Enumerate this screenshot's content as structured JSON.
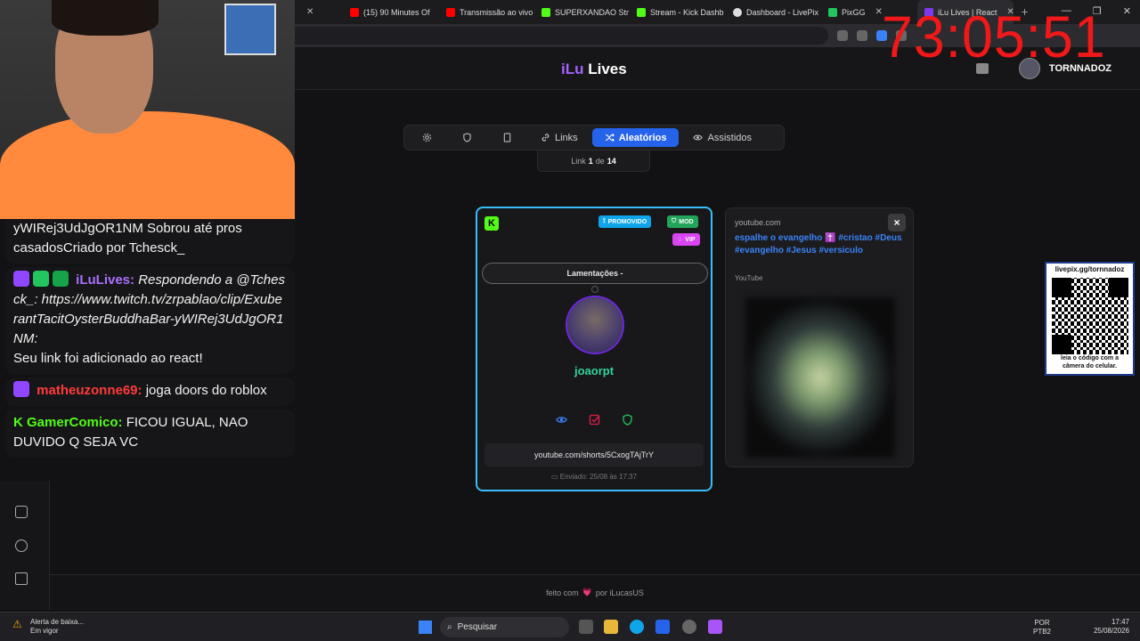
{
  "browser": {
    "tabs": [
      {
        "label": "",
        "icon": "tab-icon",
        "color": "#444444"
      },
      {
        "label": "(15) 90 Minutes Of",
        "icon": "youtube-icon",
        "color": "#ff0000"
      },
      {
        "label": "Transmissão ao vivo",
        "icon": "youtube-icon",
        "color": "#ff0000"
      },
      {
        "label": "SUPERXANDAO Str",
        "icon": "kick-icon",
        "color": "#53fc18"
      },
      {
        "label": "Stream - Kick Dashb",
        "icon": "kick-icon",
        "color": "#53fc18"
      },
      {
        "label": "Dashboard - LivePix",
        "icon": "globe-icon",
        "color": "#dddddd"
      },
      {
        "label": "PixGG",
        "icon": "pixgg-icon",
        "color": "#22c55e"
      },
      {
        "label": "iLu Lives | React",
        "icon": "ilu-icon",
        "color": "#7c3aed",
        "active": true
      }
    ]
  },
  "timer": "73:05:51",
  "header": {
    "logo_prefix": "iLu",
    "logo_suffix": " Lives",
    "username": "TORNNADOZ"
  },
  "nav": {
    "tabs": [
      {
        "label": "",
        "icon": "gear-icon"
      },
      {
        "label": "",
        "icon": "shield-icon"
      },
      {
        "label": "",
        "icon": "tablet-icon"
      },
      {
        "label": "Links",
        "icon": "link-icon"
      },
      {
        "label": "Aleatórios",
        "icon": "shuffle-icon",
        "active": true
      },
      {
        "label": "Assistidos",
        "icon": "eye-icon"
      }
    ],
    "counter_prefix": "Link",
    "counter_current": "1",
    "counter_sep": "de",
    "counter_total": "14"
  },
  "card": {
    "badges": {
      "promo": "PROMOVIDO",
      "mod": "MOD",
      "vip": "VIP"
    },
    "category": "Lamentações -",
    "username": "joaorpt",
    "link": "youtube.com/shorts/5CxogTAjTrY",
    "sent": "Enviado: 25/08 às 17:37",
    "colors": {
      "border": "#38bdf8",
      "username": "#34d399"
    }
  },
  "preview": {
    "domain": "youtube.com",
    "title": "espalhe o evangelho ✝️ #cristao #Deus #evangelho #Jesus #versiculo",
    "source": "YouTube",
    "close": "×"
  },
  "qr": {
    "header": "livepix.gg/tornnadoz",
    "footer_line1": "leia o código com a",
    "footer_line2": "câmera do celular."
  },
  "footer": {
    "made_with": "feito com",
    "heart": "💗",
    "by": "por iLucasUS"
  },
  "chat": [
    {
      "user": "",
      "text": "yWIRej3UdJgOR1NM Sobrou até pros casadosCriado por Tchesck_"
    },
    {
      "user": "iLuLives:",
      "text": "Respondendo a @Tchesck_: https://www.twitch.tv/zrpablao/clip/ExuberantTacitOysterBuddhaBar-yWIRej3UdJgOR1NM:",
      "text2": "Seu link foi adicionado ao react!"
    },
    {
      "user": "matheuzonne69:",
      "text": "joga doors do roblox"
    },
    {
      "user": "GamerComico:",
      "text": "FICOU IGUAL, NAO DUVIDO Q SEJA VC"
    }
  ],
  "taskbar": {
    "alert_line1": "Alerta de baixa...",
    "alert_line2": "Em vigor",
    "search": "Pesquisar",
    "lang_line1": "POR",
    "lang_line2": "PTB2",
    "time": "17:47",
    "date": "25/08/2026"
  }
}
